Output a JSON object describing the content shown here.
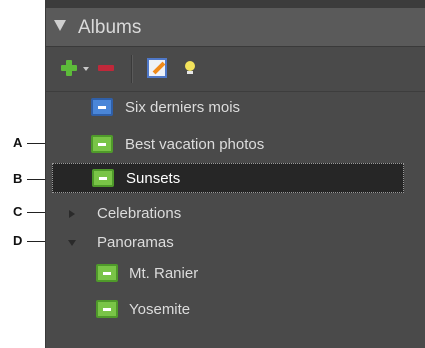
{
  "panel": {
    "title": "Albums"
  },
  "toolbar": {
    "add": "plus-icon",
    "add_menu": "dropdown-icon",
    "remove": "minus-icon",
    "edit": "edit-icon",
    "info": "lightbulb-icon"
  },
  "albums": [
    {
      "label": "Six derniers mois",
      "icon": "album-icon",
      "color": "#4a86d8"
    },
    {
      "label": "Best vacation photos",
      "icon": "album-icon",
      "color": "#79c447"
    },
    {
      "label": "Sunsets",
      "icon": "album-icon",
      "color": "#79c447",
      "selected": true
    },
    {
      "label": "Celebrations",
      "icon": "collapsed-triangle-icon"
    },
    {
      "label": "Panoramas",
      "icon": "expanded-triangle-icon"
    },
    {
      "label": "Mt. Ranier",
      "icon": "album-icon",
      "color": "#79c447"
    },
    {
      "label": "Yosemite",
      "icon": "album-icon",
      "color": "#79c447"
    }
  ],
  "callouts": [
    "A",
    "B",
    "C",
    "D"
  ]
}
